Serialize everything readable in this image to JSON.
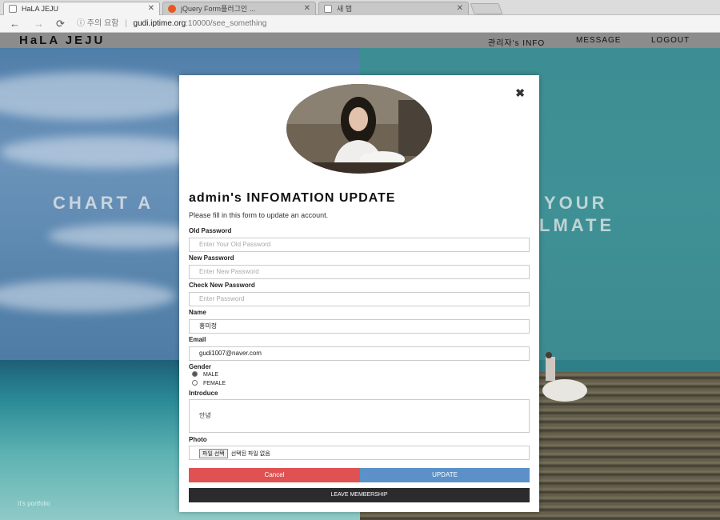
{
  "browser": {
    "tabs": [
      {
        "title": "HaLA JEJU",
        "active": true
      },
      {
        "title": "jQuery Form플러그인 ...",
        "active": false
      },
      {
        "title": "새 탭",
        "active": false
      }
    ],
    "address": {
      "security_label": "주의 요함",
      "host": "gudi.iptime.org",
      "path": ":10000/see_something"
    }
  },
  "site": {
    "logo": "HaLA JEJU",
    "nav": [
      "관리자's INFO",
      "MESSAGE",
      "LOGOUT"
    ],
    "hero_left": "CHART A",
    "hero_right_1": "YOUR",
    "hero_right_2": "LMATE",
    "footer_note": "II's portfolio"
  },
  "modal": {
    "title": "admin's INFOMATION UPDATE",
    "subtitle": "Please fill in this form to update an account.",
    "fields": {
      "old_password": {
        "label": "Old Password",
        "placeholder": "Enter Your Old Password"
      },
      "new_password": {
        "label": "New Password",
        "placeholder": "Enter New Password"
      },
      "check_password": {
        "label": "Check New Password",
        "placeholder": "Enter Password"
      },
      "name": {
        "label": "Name",
        "value": "홍미정"
      },
      "email": {
        "label": "Email",
        "value": "gudi1007@naver.com"
      },
      "gender": {
        "label": "Gender",
        "options": [
          "MALE",
          "FEMALE"
        ],
        "selected": "MALE"
      },
      "introduce": {
        "label": "Introduce",
        "value": "안녕"
      },
      "photo": {
        "label": "Photo",
        "button": "파일 선택",
        "status": "선택된 파일 없음"
      }
    },
    "buttons": {
      "cancel": "Cancel",
      "update": "UPDATE",
      "leave": "LEAVE MEMBERSHIP"
    },
    "colors": {
      "cancel": "#e05252",
      "update": "#5b91c8",
      "leave": "#2b2b2e"
    }
  }
}
